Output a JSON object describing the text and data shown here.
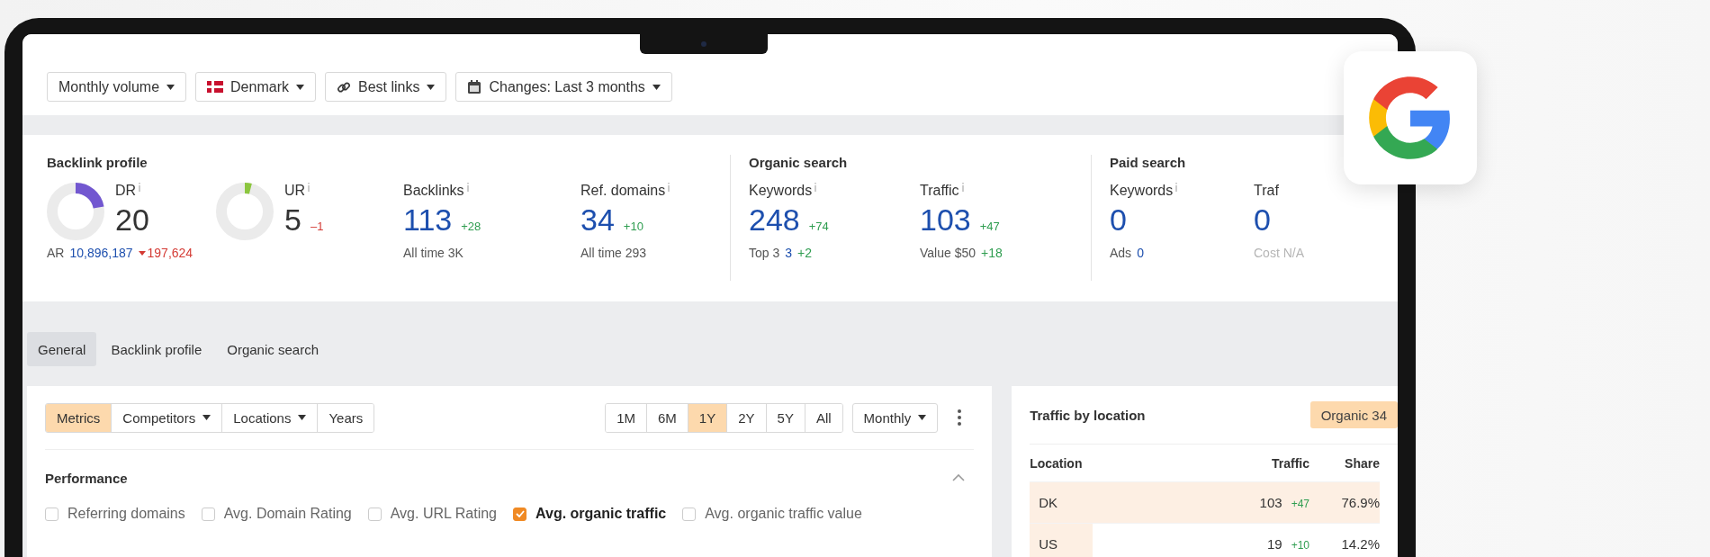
{
  "toolbar": {
    "filters": [
      {
        "label": "Monthly volume",
        "kind": "plain"
      },
      {
        "label": "Denmark",
        "kind": "flag"
      },
      {
        "label": "Best links",
        "kind": "link"
      },
      {
        "label": "Changes: Last 3 months",
        "kind": "calendar"
      }
    ]
  },
  "metrics": {
    "sections": [
      {
        "title": "Backlink profile",
        "items": [
          {
            "kind": "donut",
            "label": "DR",
            "info": true,
            "value": "20",
            "level": 0.22,
            "color": "#7257d0",
            "footer": [
              {
                "kind": "text",
                "text": "AR",
                "color": "#555555"
              },
              {
                "kind": "text",
                "text": "10,896,187",
                "color": "#1d4fae"
              },
              {
                "kind": "drop",
                "text": "197,624",
                "color": "#d43b35"
              }
            ]
          },
          {
            "kind": "donut",
            "label": "UR",
            "info": true,
            "value": "5",
            "delta": {
              "text": "–1",
              "color": "#d43b35"
            },
            "level": 0.04,
            "color": "#8cc63f"
          },
          {
            "kind": "stat",
            "label": "Backlinks",
            "info": true,
            "value": "113",
            "delta": {
              "text": "+28",
              "color": "#2f9d50"
            },
            "footer": [
              {
                "kind": "text",
                "text": "All time 3K",
                "color": "#555555"
              }
            ]
          },
          {
            "kind": "stat",
            "label": "Ref. domains",
            "info": true,
            "value": "34",
            "delta": {
              "text": "+10",
              "color": "#2f9d50"
            },
            "footer": [
              {
                "kind": "text",
                "text": "All time 293",
                "color": "#555555"
              }
            ]
          }
        ]
      },
      {
        "title": "Organic search",
        "items": [
          {
            "kind": "stat",
            "label": "Keywords",
            "info": true,
            "value": "248",
            "delta": {
              "text": "+74",
              "color": "#2f9d50"
            },
            "footer": [
              {
                "kind": "text",
                "text": "Top 3",
                "color": "#555555"
              },
              {
                "kind": "text",
                "text": "3",
                "color": "#1d4fae"
              },
              {
                "kind": "text",
                "text": "+2",
                "color": "#2f9d50"
              }
            ]
          },
          {
            "kind": "stat",
            "label": "Traffic",
            "info": true,
            "value": "103",
            "delta": {
              "text": "+47",
              "color": "#2f9d50"
            },
            "footer": [
              {
                "kind": "text",
                "text": "Value $50",
                "color": "#555555"
              },
              {
                "kind": "text",
                "text": "+18",
                "color": "#2f9d50"
              }
            ]
          }
        ]
      },
      {
        "title": "Paid search",
        "items": [
          {
            "kind": "stat",
            "label": "Keywords",
            "info": true,
            "value": "0",
            "footer": [
              {
                "kind": "text",
                "text": "Ads",
                "color": "#555555"
              },
              {
                "kind": "text",
                "text": "0",
                "color": "#1d4fae"
              }
            ]
          },
          {
            "kind": "stat",
            "label": "Traf",
            "info": false,
            "value": "0",
            "footer": [
              {
                "kind": "text",
                "text": "Cost N/A",
                "color": "#b5b5b5"
              }
            ]
          }
        ]
      }
    ]
  },
  "tabs": [
    {
      "label": "General",
      "selected": true
    },
    {
      "label": "Backlink profile",
      "selected": false
    },
    {
      "label": "Organic search",
      "selected": false
    }
  ],
  "chart_panel": {
    "modes": [
      {
        "label": "Metrics",
        "selected": true,
        "dropdown": false
      },
      {
        "label": "Competitors",
        "selected": false,
        "dropdown": true
      },
      {
        "label": "Locations",
        "selected": false,
        "dropdown": true
      },
      {
        "label": "Years",
        "selected": false,
        "dropdown": false
      }
    ],
    "periods": [
      {
        "label": "1M",
        "selected": false
      },
      {
        "label": "6M",
        "selected": false
      },
      {
        "label": "1Y",
        "selected": true
      },
      {
        "label": "2Y",
        "selected": false
      },
      {
        "label": "5Y",
        "selected": false
      },
      {
        "label": "All",
        "selected": false
      }
    ],
    "interval": "Monthly",
    "section": {
      "title": "Performance",
      "expanded": true,
      "options": [
        {
          "label": "Referring domains",
          "checked": false
        },
        {
          "label": "Avg. Domain Rating",
          "checked": false
        },
        {
          "label": "Avg. URL Rating",
          "checked": false
        },
        {
          "label": "Avg. organic traffic",
          "checked": true
        },
        {
          "label": "Avg. organic traffic value",
          "checked": false
        }
      ]
    }
  },
  "location_panel": {
    "title": "Traffic by location",
    "chip": {
      "label": "Organic 34",
      "selected": true
    },
    "columns": [
      "Location",
      "Traffic",
      "Share"
    ],
    "rows": [
      {
        "location": "DK",
        "traffic": "103",
        "delta": "+47",
        "share": "76.9%",
        "level": 1.0
      },
      {
        "location": "US",
        "traffic": "19",
        "delta": "+10",
        "share": "14.2%",
        "level": 0.18
      }
    ]
  }
}
